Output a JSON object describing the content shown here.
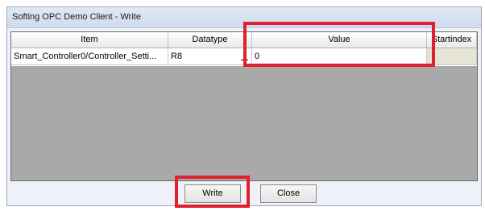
{
  "window": {
    "title": "Softing OPC Demo Client - Write"
  },
  "grid": {
    "columns": [
      "Item",
      "Datatype",
      "Value",
      "Startindex"
    ],
    "rows": [
      {
        "item": "Smart_Controller0/Controller_Setti...",
        "datatype": "R8",
        "value": "0",
        "startindex": ""
      }
    ]
  },
  "buttons": {
    "write_label": "Write",
    "close_label": "Close"
  },
  "colors": {
    "highlight": "#e0202a",
    "grid_empty_area": "#a9a9a9",
    "startindex_cell": "#e6e4d6"
  }
}
